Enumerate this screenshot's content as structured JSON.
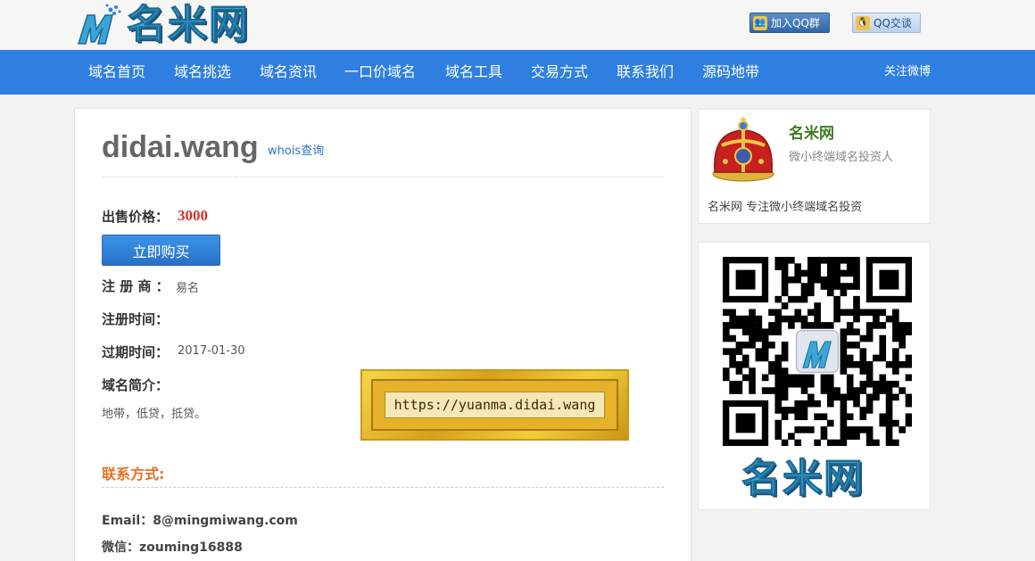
{
  "header": {
    "logo_text": "名米网",
    "qq_group_label": "加入QQ群",
    "qq_chat_label": "QQ交谈"
  },
  "nav": {
    "items": [
      "域名首页",
      "域名挑选",
      "域名资讯",
      "一口价域名",
      "域名工具",
      "交易方式",
      "联系我们",
      "源码地带"
    ],
    "follow_weibo": "关注微博"
  },
  "domain": {
    "name": "didai.wang",
    "whois_label": "whois查询",
    "price_label": "出售价格：",
    "price": "3000",
    "buy_label": "立即购买",
    "registrar_label": "注 册 商 ：",
    "registrar": "易名",
    "reg_time_label": "注册时间：",
    "expire_label": "过期时间：",
    "expire_date": "2017-01-30",
    "intro_label": "域名简介：",
    "intro": "地带，低贷，抵贷。"
  },
  "banner": {
    "url": "https://yuanma.didai.wang"
  },
  "contact": {
    "title": "联系方式:",
    "email": "Email：8@mingmiwang.com",
    "wechat": "微信：zouming16888"
  },
  "sidebar": {
    "name": "名米网",
    "subtitle": "微小终端域名投资人",
    "description": "名米网 专注微小终端域名投资",
    "qr_brand": "名米网"
  },
  "colors": {
    "nav_bg": "#2e7fdf",
    "price": "#d6302b",
    "contact_title": "#e8711f",
    "link": "#2b74c3",
    "sidebar_name": "#3d7d1f"
  }
}
